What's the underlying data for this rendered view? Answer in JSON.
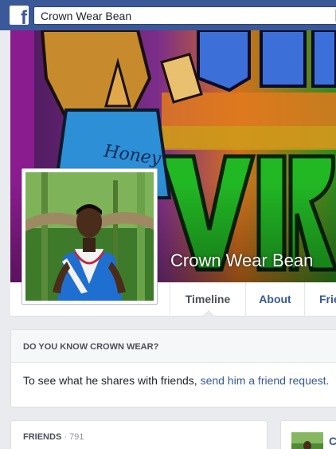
{
  "topbar": {
    "logo_glyph": "f",
    "search_value": "Crown Wear Bean",
    "color": "#3b5998"
  },
  "profile": {
    "name": "Crown Wear Bean"
  },
  "nav": {
    "tabs": [
      {
        "label": "Timeline",
        "active": true
      },
      {
        "label": "About",
        "active": false
      },
      {
        "label": "Friends",
        "active": false
      }
    ]
  },
  "do_you_know": {
    "title": "DO YOU KNOW CROWN WEAR?",
    "text": "To see what he shares with friends, ",
    "link": "send him a friend request."
  },
  "friends_box": {
    "title": "FRIENDS",
    "separator": " · ",
    "count": "791"
  },
  "post": {
    "author_initial": "C"
  },
  "colors": {
    "link": "#365899",
    "background": "#e9ebee"
  }
}
